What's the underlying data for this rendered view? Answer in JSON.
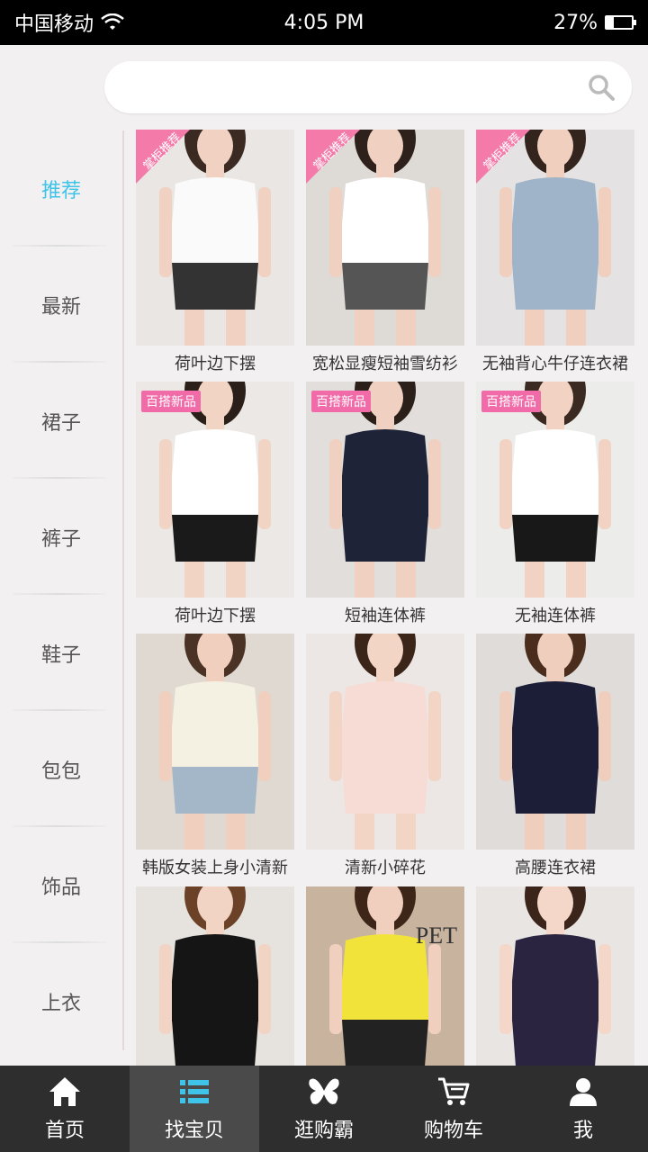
{
  "status_bar": {
    "carrier": "中国移动",
    "time": "4:05 PM",
    "battery": "27%",
    "battery_level": 0.27
  },
  "search": {
    "placeholder": "",
    "value": ""
  },
  "sidebar": {
    "accent_color": "#3fc3e8",
    "items": [
      {
        "label": "推荐",
        "active": true
      },
      {
        "label": "最新"
      },
      {
        "label": "裙子"
      },
      {
        "label": "裤子"
      },
      {
        "label": "鞋子"
      },
      {
        "label": "包包"
      },
      {
        "label": "饰品"
      },
      {
        "label": "上衣"
      }
    ]
  },
  "products": [
    {
      "title": "荷叶边下摆",
      "badge": "掌柜推荐",
      "badge_type": "corner"
    },
    {
      "title": "宽松显瘦短袖雪纺衫",
      "badge": "掌柜推荐",
      "badge_type": "corner"
    },
    {
      "title": "无袖背心牛仔连衣裙",
      "badge": "掌柜推荐",
      "badge_type": "corner"
    },
    {
      "title": "荷叶边下摆",
      "badge": "百搭新品",
      "badge_type": "tag"
    },
    {
      "title": "短袖连体裤",
      "badge": "百搭新品",
      "badge_type": "tag"
    },
    {
      "title": "无袖连体裤",
      "badge": "百搭新品",
      "badge_type": "tag"
    },
    {
      "title": "韩版女装上身小清新",
      "badge": "",
      "badge_type": ""
    },
    {
      "title": "清新小碎花",
      "badge": "",
      "badge_type": ""
    },
    {
      "title": "高腰连衣裙",
      "badge": "",
      "badge_type": ""
    },
    {
      "title": "",
      "badge": "",
      "badge_type": ""
    },
    {
      "title": "",
      "badge": "",
      "badge_type": "",
      "image_text": "PET"
    },
    {
      "title": "",
      "badge": "",
      "badge_type": ""
    }
  ],
  "bottom_nav": {
    "items": [
      {
        "label": "首页",
        "icon": "home-icon"
      },
      {
        "label": "找宝贝",
        "icon": "list-icon",
        "active": true
      },
      {
        "label": "逛购霸",
        "icon": "butterfly-icon"
      },
      {
        "label": "购物车",
        "icon": "cart-icon"
      },
      {
        "label": "我",
        "icon": "user-icon"
      }
    ]
  }
}
